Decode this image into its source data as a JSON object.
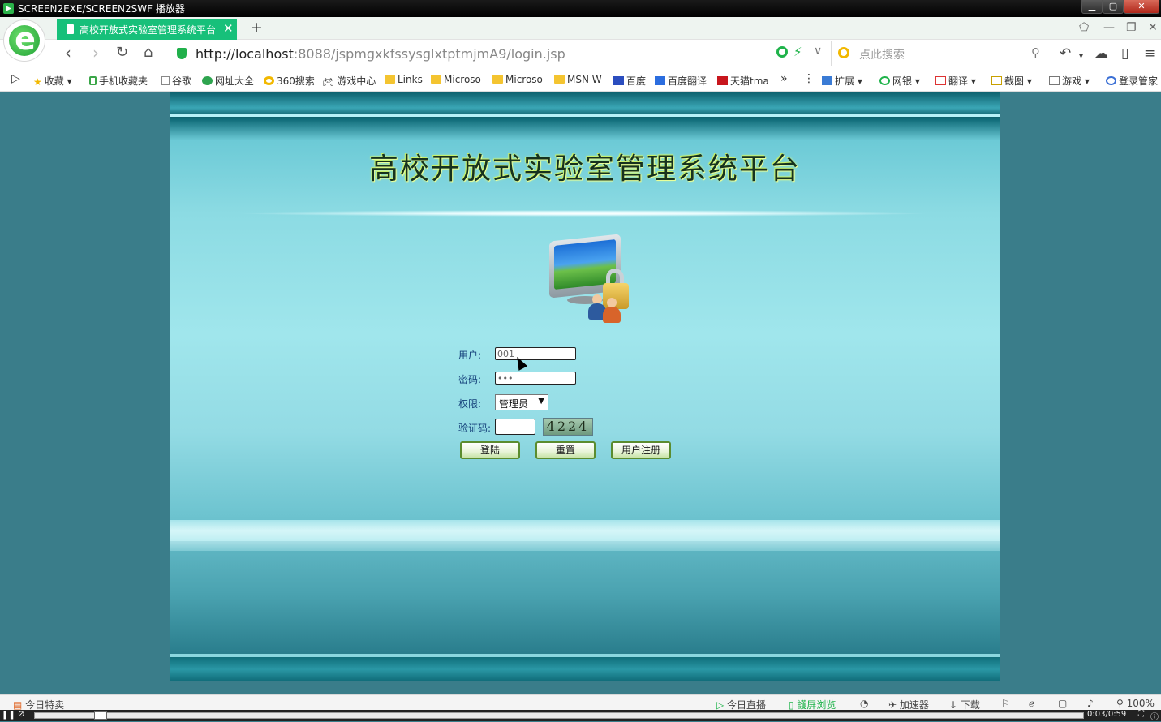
{
  "os_window": {
    "title": "SCREEN2EXE/SCREEN2SWF 播放器",
    "min": "▁",
    "max": "▢",
    "close": "✕"
  },
  "browser": {
    "tab_title": "高校开放式实验室管理系统平台",
    "tab_close": "✕",
    "new_tab": "+",
    "tabbar_icons": [
      "shirt-icon",
      "minimize-icon",
      "restore-icon",
      "close-icon"
    ],
    "url_host": "http://localhost",
    "url_path": ":8088/jspmgxkfssysglxtptmjmA9/login.jsp",
    "search_placeholder": "点此搜索",
    "nav_icons": [
      "back-icon",
      "forward-icon",
      "reload-icon",
      "home-icon"
    ],
    "bookmarks": [
      {
        "label": "收藏",
        "icon": "star-icon"
      },
      {
        "label": "手机收藏夹",
        "icon": "phone-icon"
      },
      {
        "label": "谷歌",
        "icon": "page-icon"
      },
      {
        "label": "网址大全",
        "icon": "globe-icon"
      },
      {
        "label": "360搜索",
        "icon": "search-360-icon"
      },
      {
        "label": "游戏中心",
        "icon": "gamepad-icon"
      },
      {
        "label": "Links",
        "icon": "folder-icon"
      },
      {
        "label": "Microso",
        "icon": "folder-icon"
      },
      {
        "label": "Microso",
        "icon": "folder-icon"
      },
      {
        "label": "MSN W",
        "icon": "folder-icon"
      },
      {
        "label": "百度",
        "icon": "baidu-icon"
      },
      {
        "label": "百度翻译",
        "icon": "translate-icon"
      },
      {
        "label": "天猫tma",
        "icon": "tmall-icon"
      }
    ],
    "bookmarks_more": "»",
    "extensions": [
      {
        "label": "扩展",
        "icon": "extensions-icon"
      },
      {
        "label": "网银",
        "icon": "bank-icon"
      },
      {
        "label": "翻译",
        "icon": "translate-icon"
      },
      {
        "label": "截图",
        "icon": "screenshot-icon"
      },
      {
        "label": "游戏",
        "icon": "game-icon"
      },
      {
        "label": "登录管家",
        "icon": "login-manager-icon"
      }
    ]
  },
  "page": {
    "title": "高校开放式实验室管理系统平台",
    "form": {
      "user_label": "用户:",
      "user_value": "001",
      "password_label": "密码:",
      "password_value": "•••",
      "role_label": "权限:",
      "role_selected": "管理员",
      "captcha_label": "验证码:",
      "captcha_value": "",
      "captcha_code": "4224",
      "login_button": "登陆",
      "reset_button": "重置",
      "register_button": "用户注册"
    }
  },
  "statusbar": {
    "left": "今日特卖",
    "items": [
      "今日直播",
      "護屏浏览",
      "加速器",
      "下载"
    ],
    "zoom": "100%"
  },
  "player": {
    "time": "0:03/0:59"
  },
  "colors": {
    "tab_active": "#17c07a",
    "page_bg": "#3a7d8a",
    "form_label": "#14407a"
  }
}
